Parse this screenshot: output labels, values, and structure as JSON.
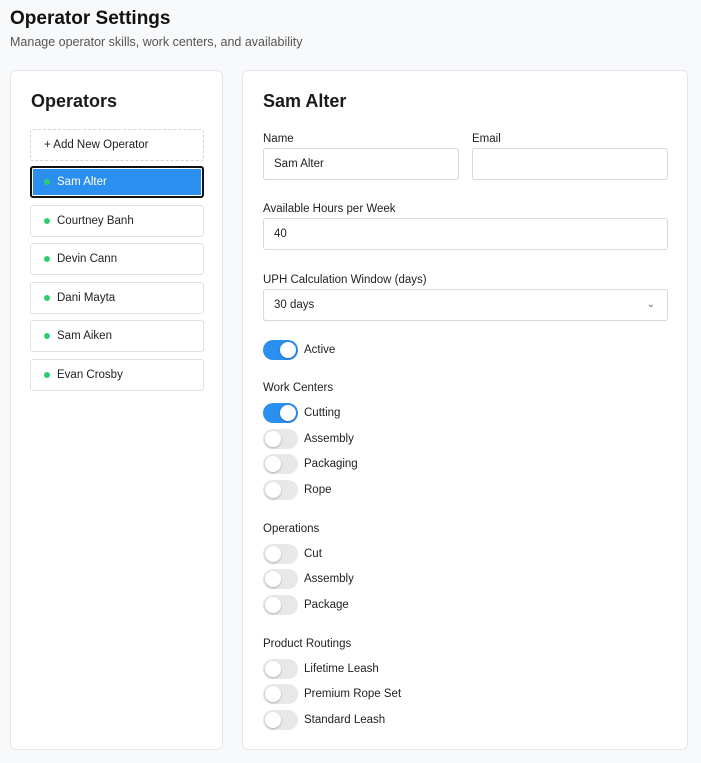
{
  "header": {
    "title": "Operator Settings",
    "subtitle": "Manage operator skills, work centers, and availability"
  },
  "sidebar": {
    "title": "Operators",
    "add_label": "+ Add New Operator",
    "operators": [
      {
        "name": "Sam Alter",
        "status": "active",
        "selected": true
      },
      {
        "name": "Courtney Banh",
        "status": "active",
        "selected": false
      },
      {
        "name": "Devin Cann",
        "status": "active",
        "selected": false
      },
      {
        "name": "Dani Mayta",
        "status": "active",
        "selected": false
      },
      {
        "name": "Sam Aiken",
        "status": "active",
        "selected": false
      },
      {
        "name": "Evan Crosby",
        "status": "active",
        "selected": false
      }
    ]
  },
  "detail": {
    "title": "Sam Alter",
    "name_label": "Name",
    "name_value": "Sam Alter",
    "email_label": "Email",
    "email_value": "",
    "hours_label": "Available Hours per Week",
    "hours_value": "40",
    "uph_label": "UPH Calculation Window (days)",
    "uph_value": "30 days",
    "active_label": "Active",
    "active_on": true,
    "work_centers_label": "Work Centers",
    "work_centers": [
      {
        "label": "Cutting",
        "on": true
      },
      {
        "label": "Assembly",
        "on": false
      },
      {
        "label": "Packaging",
        "on": false
      },
      {
        "label": "Rope",
        "on": false
      }
    ],
    "operations_label": "Operations",
    "operations": [
      {
        "label": "Cut",
        "on": false
      },
      {
        "label": "Assembly",
        "on": false
      },
      {
        "label": "Package",
        "on": false
      }
    ],
    "routings_label": "Product Routings",
    "routings": [
      {
        "label": "Lifetime Leash",
        "on": false
      },
      {
        "label": "Premium Rope Set",
        "on": false
      },
      {
        "label": "Standard Leash",
        "on": false
      }
    ]
  },
  "colors": {
    "accent": "#2b8ff0",
    "status_dot": "#2ecc71"
  }
}
